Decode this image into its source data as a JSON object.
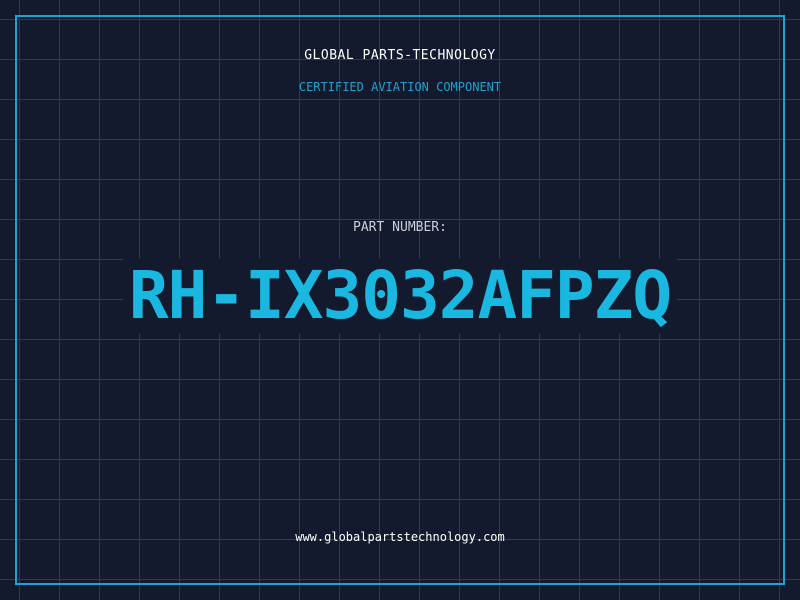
{
  "header": {
    "company": "GLOBAL PARTS-TECHNOLOGY",
    "tagline": "CERTIFIED AVIATION COMPONENT"
  },
  "part": {
    "label": "PART NUMBER:",
    "number": "RH-IX3032AFPZQ"
  },
  "footer": {
    "website": "www.globalpartstechnology.com"
  },
  "colors": {
    "background": "#131a2e",
    "grid": "#1f4a5e",
    "accent": "#1fa2cf",
    "part_number": "#1ab8e0",
    "text": "#ffffff"
  }
}
